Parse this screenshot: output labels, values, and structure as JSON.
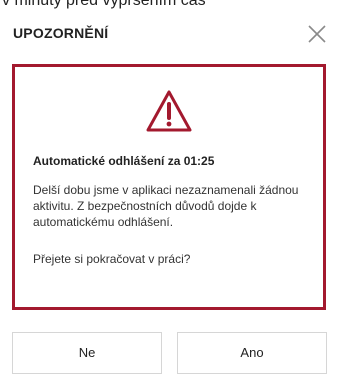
{
  "background_text": "v minuty pred vypršením čas",
  "dialog": {
    "title": "UPOZORNĚNÍ",
    "close_icon": "close-x-icon",
    "alert": {
      "icon": "warning-triangle-icon",
      "accent_color": "#a3192e",
      "countdown_text": "Automatické odhlášení za 01:25",
      "message": "Delší dobu jsme v aplikaci nezaznamenali žádnou aktivitu. Z bezpečnostních důvodů dojde k automatickému odhlášení.",
      "question": "Přejete si pokračovat v práci?"
    },
    "buttons": {
      "no_label": "Ne",
      "yes_label": "Ano"
    }
  }
}
